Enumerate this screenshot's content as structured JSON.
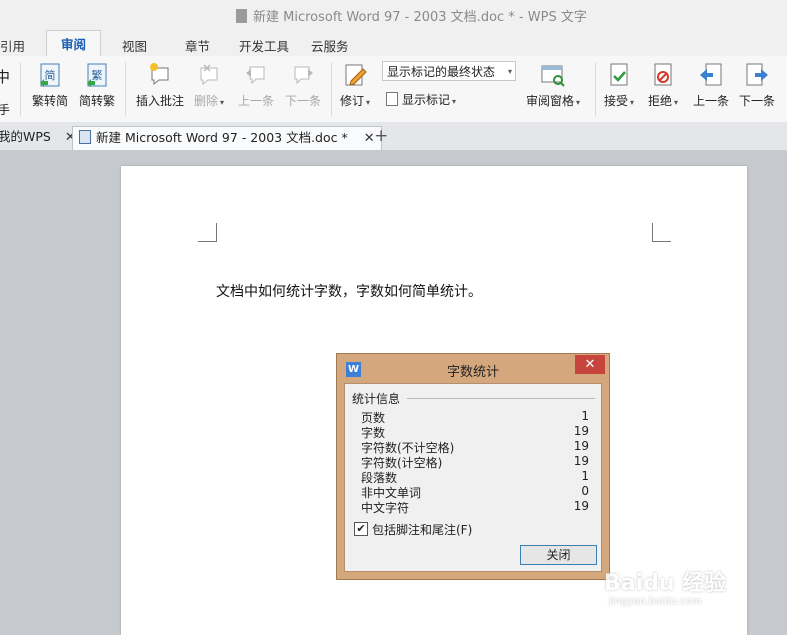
{
  "window": {
    "title": "新建 Microsoft Word 97 - 2003 文档.doc * - WPS 文字"
  },
  "menu": {
    "tabs": [
      "引用",
      "审阅",
      "视图",
      "章节",
      "开发工具",
      "云服务"
    ],
    "active": "审阅"
  },
  "ribbon": {
    "trad_to_simp": "繁转简",
    "simp_to_trad": "简转繁",
    "trad_glyph": "繁",
    "simp_glyph": "简",
    "insert_comment": "插入批注",
    "delete": "删除",
    "prev_comment": "上一条",
    "next_comment": "下一条",
    "revise": "修订",
    "markup_state": "显示标记的最终状态",
    "show_markup": "显示标记",
    "review_pane": "审阅窗格",
    "accept": "接受",
    "reject": "拒绝",
    "prev_change": "上一条",
    "next_change": "下一条",
    "left_cut_label": "中",
    "left_cut_label2": "手"
  },
  "doc_tabs": {
    "tabs": [
      "我的WPS",
      "新建 Microsoft Word 97 - 2003 文档.doc *"
    ]
  },
  "document": {
    "text": "文档中如何统计字数，字数如何简单统计。"
  },
  "dialog": {
    "title": "字数统计",
    "group_label": "统计信息",
    "stats": [
      {
        "label": "页数",
        "value": "1"
      },
      {
        "label": "字数",
        "value": "19"
      },
      {
        "label": "字符数(不计空格)",
        "value": "19"
      },
      {
        "label": "字符数(计空格)",
        "value": "19"
      },
      {
        "label": "段落数",
        "value": "1"
      },
      {
        "label": "非中文单词",
        "value": "0"
      },
      {
        "label": "中文字符",
        "value": "19"
      }
    ],
    "checkbox_label": "包括脚注和尾注(F)",
    "checkbox_checked": "✔",
    "close_button": "关闭",
    "close_x": "✕",
    "icon_letter": "W"
  },
  "watermark": {
    "brand": "Baidu 经验",
    "url": "jingyan.baidu.com"
  }
}
